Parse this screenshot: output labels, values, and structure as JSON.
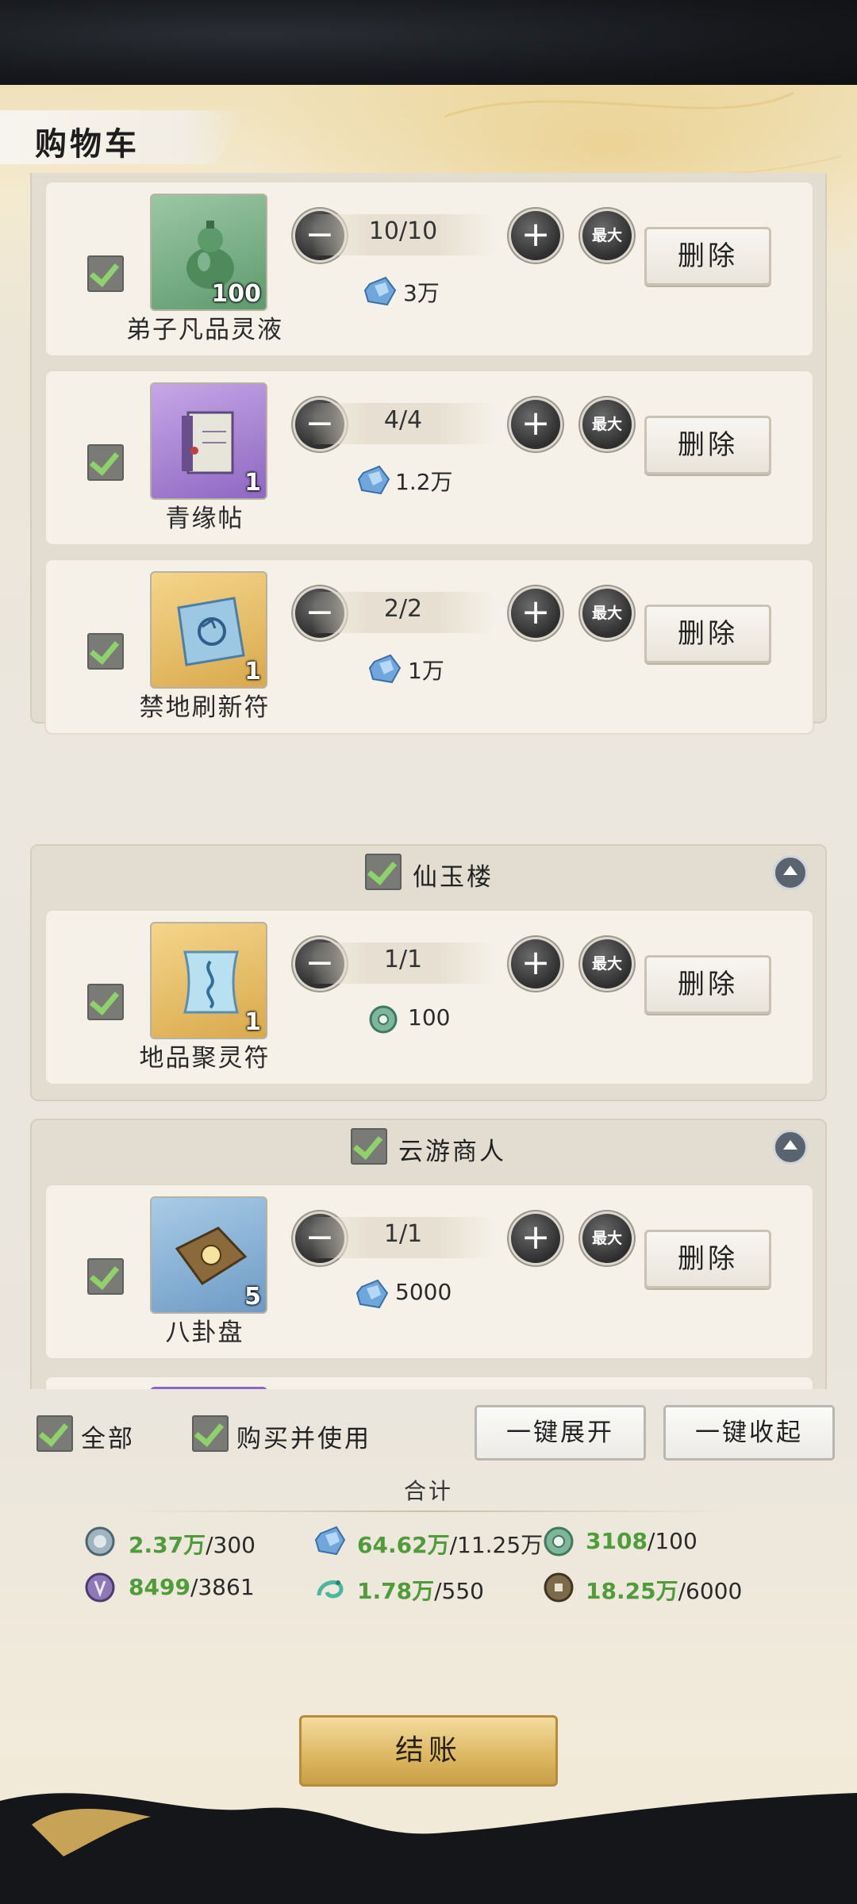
{
  "header": {
    "title": "购物车"
  },
  "groups": [
    {
      "name": "",
      "items": [
        {
          "name": "弟子凡品灵液",
          "count": "100",
          "qty": "10/10",
          "price": "3万",
          "currency": "spirit-stone"
        },
        {
          "name": "青缘帖",
          "count": "1",
          "qty": "4/4",
          "price": "1.2万",
          "currency": "spirit-stone"
        },
        {
          "name": "禁地刷新符",
          "count": "1",
          "qty": "2/2",
          "price": "1万",
          "currency": "spirit-stone"
        }
      ]
    },
    {
      "name": "仙玉楼",
      "items": [
        {
          "name": "地品聚灵符",
          "count": "1",
          "qty": "1/1",
          "price": "100",
          "currency": "jade-coin"
        }
      ]
    },
    {
      "name": "云游商人",
      "items": [
        {
          "name": "八卦盘",
          "count": "5",
          "qty": "1/1",
          "price": "5000",
          "currency": "spirit-stone"
        }
      ]
    }
  ],
  "labels": {
    "max": "最大",
    "delete": "删除",
    "minus": "−",
    "plus": "+"
  },
  "footer": {
    "select_all": "全部",
    "buy_and_use": "购买并使用",
    "expand_all": "一键展开",
    "collapse_all": "一键收起",
    "total_label": "合计",
    "totals": [
      {
        "icon": "silver-token-icon",
        "amount": "2.37万",
        "limit": "/300"
      },
      {
        "icon": "spirit-stone-icon",
        "amount": "64.62万",
        "limit": "/11.25万"
      },
      {
        "icon": "jade-coin-icon",
        "amount": "3108",
        "limit": "/100"
      },
      {
        "icon": "purple-token-icon",
        "amount": "8499",
        "limit": "/3861"
      },
      {
        "icon": "dragon-token-icon",
        "amount": "1.78万",
        "limit": "/550"
      },
      {
        "icon": "copper-coin-icon",
        "amount": "18.25万",
        "limit": "/6000"
      }
    ],
    "checkout": "结账"
  },
  "colors": {
    "accent_green": "#4f9c3a",
    "checkbox_tick": "#8fd16a",
    "checkout_gold": "#dcb660"
  }
}
